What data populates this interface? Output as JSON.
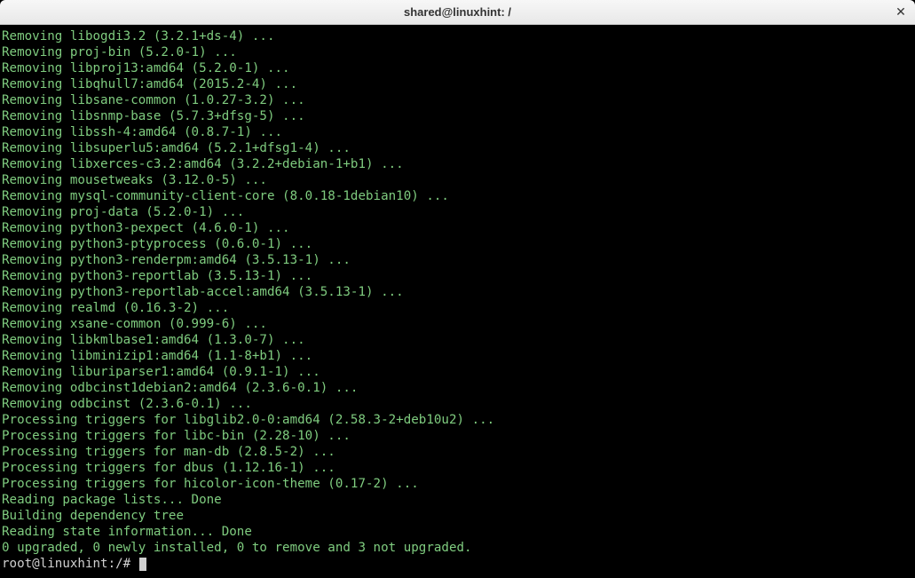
{
  "titlebar": {
    "title": "shared@linuxhint: /"
  },
  "terminal": {
    "lines": [
      "Removing libogdi3.2 (3.2.1+ds-4) ...",
      "Removing proj-bin (5.2.0-1) ...",
      "Removing libproj13:amd64 (5.2.0-1) ...",
      "Removing libqhull7:amd64 (2015.2-4) ...",
      "Removing libsane-common (1.0.27-3.2) ...",
      "Removing libsnmp-base (5.7.3+dfsg-5) ...",
      "Removing libssh-4:amd64 (0.8.7-1) ...",
      "Removing libsuperlu5:amd64 (5.2.1+dfsg1-4) ...",
      "Removing libxerces-c3.2:amd64 (3.2.2+debian-1+b1) ...",
      "Removing mousetweaks (3.12.0-5) ...",
      "Removing mysql-community-client-core (8.0.18-1debian10) ...",
      "Removing proj-data (5.2.0-1) ...",
      "Removing python3-pexpect (4.6.0-1) ...",
      "Removing python3-ptyprocess (0.6.0-1) ...",
      "Removing python3-renderpm:amd64 (3.5.13-1) ...",
      "Removing python3-reportlab (3.5.13-1) ...",
      "Removing python3-reportlab-accel:amd64 (3.5.13-1) ...",
      "Removing realmd (0.16.3-2) ...",
      "Removing xsane-common (0.999-6) ...",
      "Removing libkmlbase1:amd64 (1.3.0-7) ...",
      "Removing libminizip1:amd64 (1.1-8+b1) ...",
      "Removing liburiparser1:amd64 (0.9.1-1) ...",
      "Removing odbcinst1debian2:amd64 (2.3.6-0.1) ...",
      "Removing odbcinst (2.3.6-0.1) ...",
      "Processing triggers for libglib2.0-0:amd64 (2.58.3-2+deb10u2) ...",
      "Processing triggers for libc-bin (2.28-10) ...",
      "Processing triggers for man-db (2.8.5-2) ...",
      "Processing triggers for dbus (1.12.16-1) ...",
      "Processing triggers for hicolor-icon-theme (0.17-2) ...",
      "Reading package lists... Done",
      "Building dependency tree       ",
      "Reading state information... Done",
      "0 upgraded, 0 newly installed, 0 to remove and 3 not upgraded."
    ],
    "prompt": "root@linuxhint:/#"
  }
}
